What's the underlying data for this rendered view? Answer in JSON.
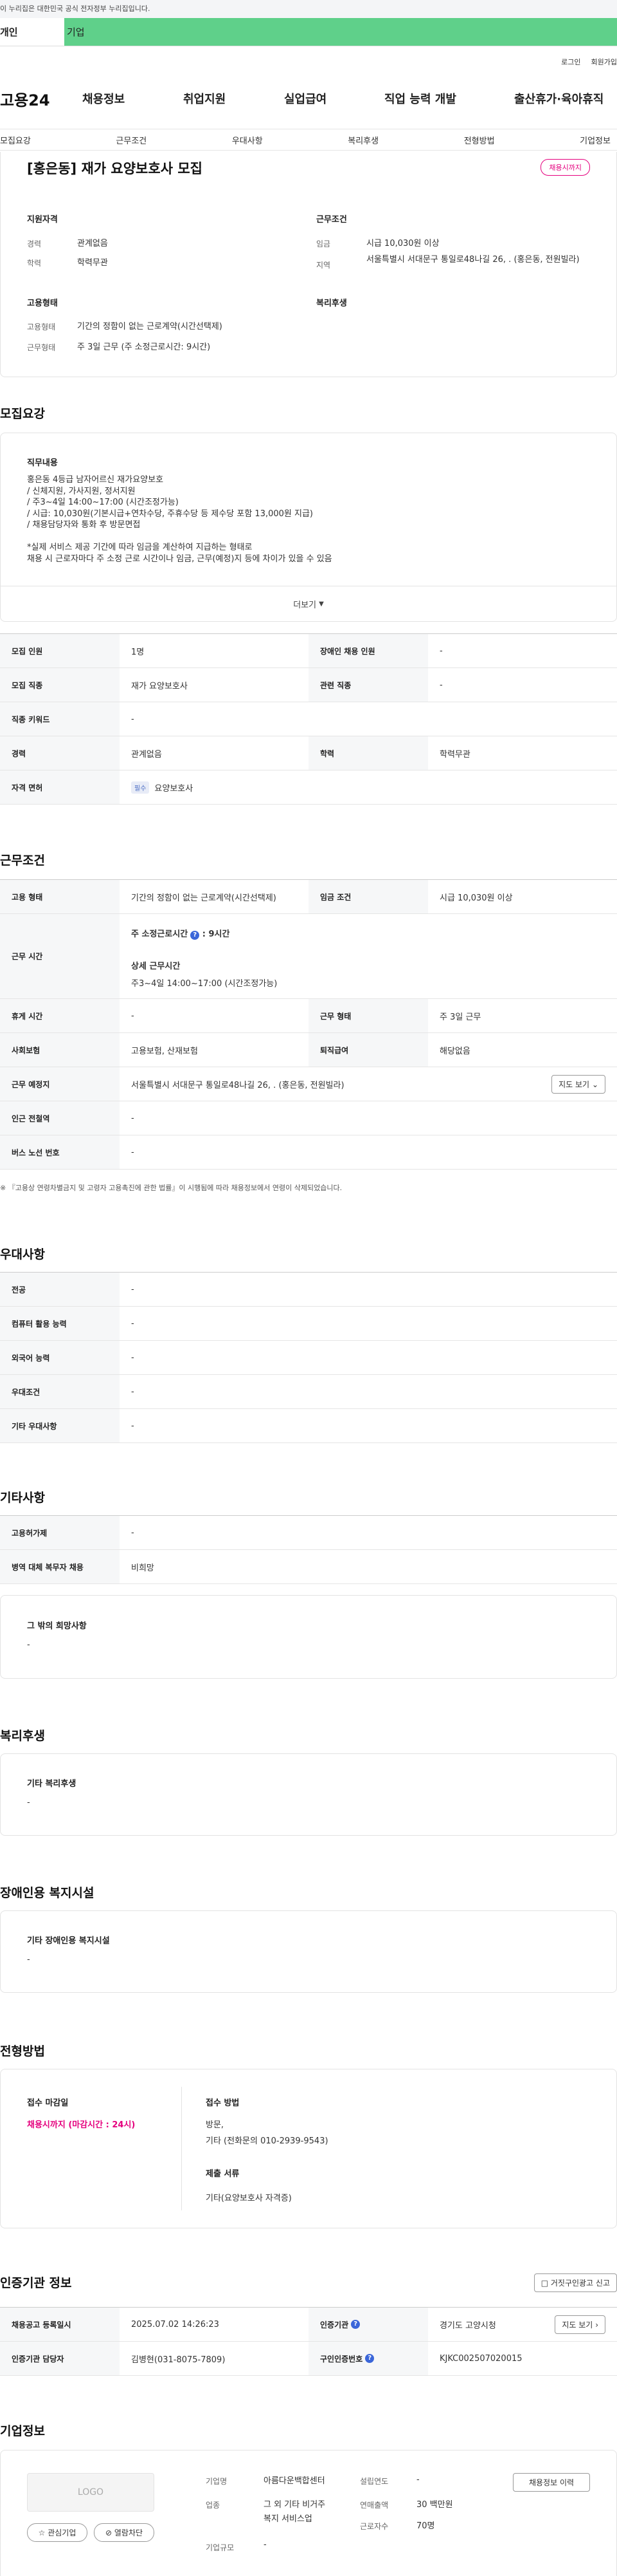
{
  "gov_notice": "이 누리집은 대한민국 공식 전자정부 누리집입니다.",
  "user_tabs": {
    "personal": "개인",
    "company": "기업"
  },
  "top_links": {
    "login": "로그인",
    "signup": "회원가입"
  },
  "logo": "고용24",
  "gnb": [
    "채용정보",
    "취업지원",
    "실업급여",
    "직업 능력 개발",
    "출산휴가·육아휴직"
  ],
  "subnav": [
    "모집요강",
    "근무조건",
    "우대사항",
    "복리후생",
    "전형방법",
    "기업정보"
  ],
  "summary": {
    "title": "[홍은동] 재가 요양보호사 모집",
    "deadline_badge": "채용시까지",
    "qualification_head": "지원자격",
    "career_label": "경력",
    "career": "관계없음",
    "education_label": "학력",
    "education": "학력무관",
    "employment_head": "고용형태",
    "emp_type_label": "고용형태",
    "emp_type": "기간의 정함이 없는 근로계약(시간선택제)",
    "work_type_label": "근무형태",
    "work_type": "주 3일 근무 (주 소정근로시간: 9시간)",
    "conditions_head": "근무조건",
    "wage_label": "임금",
    "wage": "시급 10,030원 이상",
    "region_label": "지역",
    "region": "서울특별시 서대문구 통일로48나길 26, . (홍은동, 전원빌라)",
    "welfare_head": "복리후생"
  },
  "recruit": {
    "section_title": "모집요강",
    "duties_title": "직무내용",
    "duties_lines": [
      "홍은동 4등급 남자어르신 재가요양보호",
      "/ 신체지원, 가사지원, 정서지원",
      "/ 주3~4일 14:00~17:00 (시간조정가능)",
      "/ 시급: 10,030원(기본시급+연차수당, 주휴수당 등 제수당 포함 13,000원 지급)",
      "/ 채용담당자와 통화 후 방문면접",
      "",
      "*실제 서비스 제공 기간에 따라 임금을 계산하여 지급하는 형태로",
      "채용 시 근로자마다 주 소정 근로 시간이나 임금, 근무(예정)지 등에 차이가 있을 수 있음"
    ],
    "more_label": "더보기",
    "headcount_label": "모집 인원",
    "headcount": "1명",
    "disabled_label": "장애인 채용 인원",
    "disabled": "-",
    "job_label": "모집 직종",
    "job": "재가 요양보호사",
    "related_label": "관련 직종",
    "related": "-",
    "keyword_label": "직종 키워드",
    "keyword": "-",
    "career_label": "경력",
    "career": "관계없음",
    "education_label": "학력",
    "education": "학력무관",
    "license_label": "자격 면허",
    "license_chip": "필수",
    "license": "요양보호사"
  },
  "conditions": {
    "section_title": "근무조건",
    "emp_label": "고용 형태",
    "emp": "기간의 정함이 없는 근로계약(시간선택제)",
    "wage_label": "임금 조건",
    "wage": "시급 10,030원 이상",
    "hours_label": "근무 시간",
    "weekly_hours": "주 소정근로시간",
    "weekly_hours_value": ": 9시간",
    "detail_hours_title": "상세 근무시간",
    "detail_hours": "주3~4일 14:00~17:00 (시간조정가능)",
    "rest_label": "휴게 시간",
    "rest": "-",
    "worktype_label": "근무 형태",
    "worktype": "주 3일 근무",
    "insurance_label": "사회보험",
    "insurance": "고용보험, 산재보험",
    "retire_label": "퇴직급여",
    "retire": "해당없음",
    "place_label": "근무 예정지",
    "place": "서울특별시 서대문구 통일로48나길 26, . (홍은동, 전원빌라)",
    "map_button": "지도 보기",
    "subway_label": "인근 전철역",
    "subway": "-",
    "bus_label": "버스 노선 번호",
    "bus": "-",
    "note": "※ 『고용상 연령차별금지 및 고령자 고용촉진에 관한 법률』이 시행됨에 따라 채용정보에서 연령이 삭제되었습니다."
  },
  "preferences": {
    "section_title": "우대사항",
    "major_label": "전공",
    "major": "-",
    "computer_label": "컴퓨터 활용 능력",
    "computer": "-",
    "language_label": "외국어 능력",
    "language": "-",
    "pref_label": "우대조건",
    "pref": "-",
    "etc_label": "기타 우대사항",
    "etc": "-"
  },
  "others": {
    "section_title": "기타사항",
    "permit_label": "고용허가제",
    "permit": "-",
    "military_label": "병역 대체 복무자 채용",
    "military": "비희망",
    "hope_title": "그 밖의 희망사항",
    "hope": "-"
  },
  "welfare": {
    "section_title": "복리후생",
    "box_title": "기타 복리후생",
    "box_value": "-"
  },
  "disabled_facility": {
    "section_title": "장애인용 복지시설",
    "box_title": "기타 장애인용 복지시설",
    "box_value": "-"
  },
  "selection": {
    "section_title": "전형방법",
    "deadline_title": "접수 마감일",
    "deadline_value": "채용시까지 (마감시간 : 24시)",
    "method_title": "접수 방법",
    "method_line1": "방문,",
    "method_line2": "기타 (전화문의 010-2939-9543)",
    "docs_title": "제출 서류",
    "docs_value": "기타(요양보호사 자격증)"
  },
  "certifier": {
    "section_title": "인증기관 정보",
    "report_button": "거짓구인광고 신고",
    "reg_date_label": "채용공고 등록일시",
    "reg_date": "2025.07.02 14:26:23",
    "agency_label": "인증기관",
    "agency": "경기도 고양시청",
    "map_button": "지도 보기",
    "manager_label": "인증기관 담당자",
    "manager": "김병현(031-8075-7809)",
    "id_label": "구인인증번호",
    "id": "KJKC002507020015"
  },
  "company": {
    "section_title": "기업정보",
    "logo_placeholder": "LOGO",
    "favorite_button": "관심기업",
    "block_button": "열람차단",
    "name_label": "기업명",
    "name": "아름다운백합센터",
    "industry_label": "업종",
    "industry_line1": "그 외 기타 비거주",
    "industry_line2": "복지 서비스업",
    "size_label": "기업규모",
    "size": "-",
    "founded_label": "설립연도",
    "founded": "-",
    "revenue_label": "연매출액",
    "revenue": "30 백만원",
    "employees_label": "근로자수",
    "employees": "70명",
    "recruit_history_button": "채용정보 이력"
  }
}
